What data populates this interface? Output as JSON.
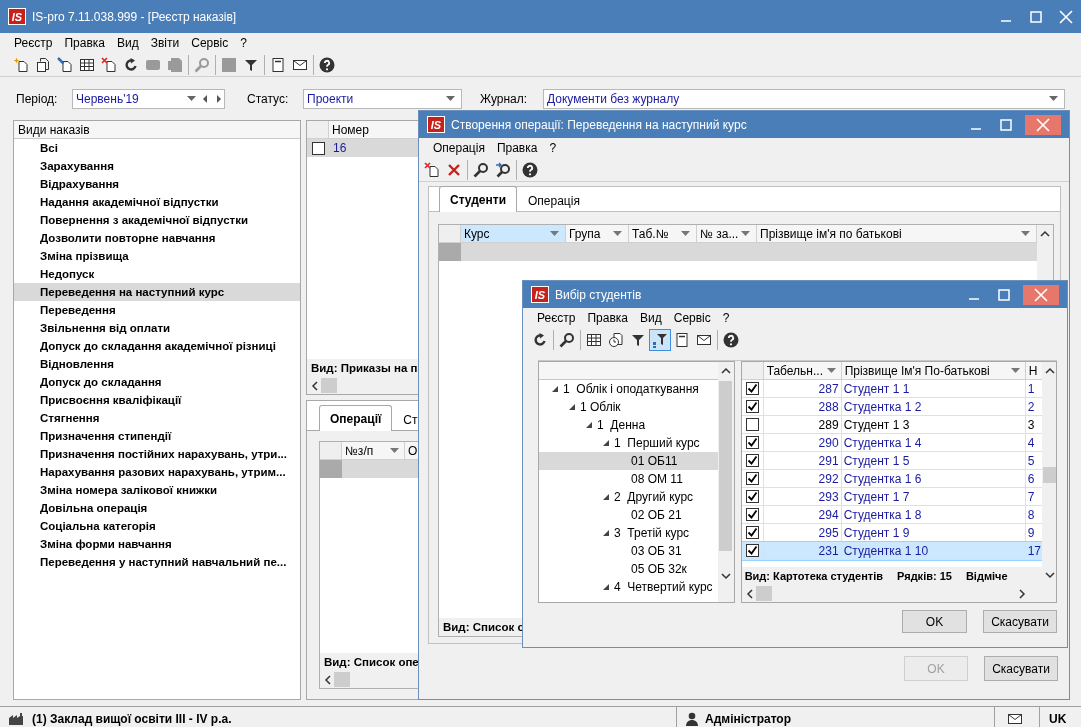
{
  "window": {
    "logo": "IS",
    "title": "IS-pro 7.11.038.999 - [Реєстр наказів]"
  },
  "menu": [
    "Реєстр",
    "Правка",
    "Вид",
    "Звіти",
    "Сервіс",
    "?"
  ],
  "toolbar": [
    {
      "kind": "new",
      "disabled": false
    },
    {
      "kind": "copy",
      "disabled": false
    },
    {
      "kind": "edit",
      "disabled": false
    },
    {
      "kind": "table",
      "disabled": false
    },
    {
      "kind": "delete",
      "disabled": false
    },
    {
      "kind": "refresh",
      "disabled": false
    },
    {
      "kind": "block",
      "disabled": true
    },
    {
      "kind": "pages",
      "disabled": true
    },
    {
      "kind": "separator"
    },
    {
      "kind": "search",
      "disabled": true
    },
    {
      "kind": "separator"
    },
    {
      "kind": "square",
      "disabled": true
    },
    {
      "kind": "filter",
      "disabled": false
    },
    {
      "kind": "separator"
    },
    {
      "kind": "document",
      "disabled": false
    },
    {
      "kind": "mail",
      "disabled": false
    },
    {
      "kind": "separator"
    },
    {
      "kind": "help",
      "disabled": false
    }
  ],
  "filters": {
    "period_label": "Період:",
    "period": "Червень'19",
    "status_label": "Статус:",
    "status": "Проекти",
    "journal_label": "Журнал:",
    "journal": "Документи без журналу"
  },
  "order_types": {
    "header": "Види наказів",
    "items": [
      {
        "label": "Всі",
        "selected": false
      },
      {
        "label": "Зарахування",
        "selected": false
      },
      {
        "label": "Відрахування",
        "selected": false
      },
      {
        "label": "Надання академічної відпустки",
        "selected": false
      },
      {
        "label": "Повернення з академічної відпустки",
        "selected": false
      },
      {
        "label": "Дозволити повторне навчання",
        "selected": false
      },
      {
        "label": "Зміна прізвища",
        "selected": false
      },
      {
        "label": "Недопуск",
        "selected": false
      },
      {
        "label": "Переведення на наступний курс",
        "selected": true
      },
      {
        "label": "Переведення",
        "selected": false
      },
      {
        "label": "Звільнення від оплати",
        "selected": false
      },
      {
        "label": "Допуск до складання академічної різниці",
        "selected": false
      },
      {
        "label": "Відновлення",
        "selected": false
      },
      {
        "label": "Допуск до складання",
        "selected": false
      },
      {
        "label": "Присвоєння кваліфікації",
        "selected": false
      },
      {
        "label": "Стягнення",
        "selected": false
      },
      {
        "label": "Призначення стипендії",
        "selected": false
      },
      {
        "label": "Призначення постійних нарахувань, утри...",
        "selected": false
      },
      {
        "label": "Нарахування разових нарахувань, утрим...",
        "selected": false
      },
      {
        "label": "Зміна номера залікової книжки",
        "selected": false
      },
      {
        "label": "Довільна операція",
        "selected": false
      },
      {
        "label": "Соціальна категорія",
        "selected": false
      },
      {
        "label": "Зміна форми навчання",
        "selected": false
      },
      {
        "label": "Переведення у наступний навчальний пе...",
        "selected": false
      }
    ]
  },
  "orders_table": {
    "columns": [
      "Номер"
    ],
    "rows": [
      {
        "number": "16",
        "checked": false,
        "selected": true
      }
    ],
    "footer": "Вид: Приказы на п"
  },
  "bottom_tabs": [
    {
      "label": "Операції",
      "selected": true
    },
    {
      "label": "Ст",
      "selected": false
    }
  ],
  "operations_table": {
    "columns": [
      "№з/п",
      "О"
    ],
    "footer": "Вид: Список опе"
  },
  "status_bar": {
    "organization": "(1) Заклад вищої освіти III - IV р.а.",
    "user": "Адміністратор",
    "language": "UK"
  },
  "operation_dialog": {
    "logo": "IS",
    "title": "Створення операції: Переведення на наступний курс",
    "menu": [
      "Операція",
      "Правка",
      "?"
    ],
    "toolbar": [
      {
        "kind": "delete"
      },
      {
        "kind": "delete-x"
      },
      {
        "kind": "separator"
      },
      {
        "kind": "search"
      },
      {
        "kind": "search-arrow"
      },
      {
        "kind": "separator"
      },
      {
        "kind": "help"
      }
    ],
    "tabs": [
      {
        "label": "Студенти",
        "selected": true
      },
      {
        "label": "Операція",
        "selected": false
      }
    ],
    "columns": [
      {
        "label": "Курс",
        "selected": true
      },
      {
        "label": "Група",
        "selected": false
      },
      {
        "label": "Таб.№",
        "selected": false
      },
      {
        "label": "№ за...",
        "selected": false
      },
      {
        "label": "Прізвище ім'я по батькові",
        "selected": false
      }
    ],
    "footer": "Вид: Список с",
    "buttons": [
      {
        "label": "OK",
        "disabled": true
      },
      {
        "label": "Скасувати",
        "disabled": false
      }
    ]
  },
  "students_dialog": {
    "logo": "IS",
    "title": "Вибір студентів",
    "menu": [
      "Реєстр",
      "Правка",
      "Вид",
      "Сервіс",
      "?"
    ],
    "toolbar": [
      {
        "kind": "refresh",
        "selected": false
      },
      {
        "kind": "separator"
      },
      {
        "kind": "search",
        "selected": false
      },
      {
        "kind": "separator"
      },
      {
        "kind": "table",
        "selected": false
      },
      {
        "kind": "clock-document",
        "selected": false
      },
      {
        "kind": "filter",
        "selected": false
      },
      {
        "kind": "filter-tree",
        "selected": true
      },
      {
        "kind": "document",
        "selected": false
      },
      {
        "kind": "mail",
        "selected": false
      },
      {
        "kind": "separator"
      },
      {
        "kind": "help",
        "selected": false
      }
    ],
    "tree": [
      {
        "label": "1  Облік і оподаткування",
        "expanded": true,
        "selected": false,
        "children": [
          {
            "label": "1 Облік",
            "expanded": true,
            "selected": false,
            "children": [
              {
                "label": "1  Денна",
                "expanded": true,
                "selected": false,
                "children": [
                  {
                    "label": "1  Перший курс",
                    "expanded": true,
                    "selected": false,
                    "children": [
                      {
                        "label": "01 ОБ11",
                        "selected": true
                      },
                      {
                        "label": "08 ОМ 11",
                        "selected": false
                      }
                    ]
                  },
                  {
                    "label": "2  Другий курс",
                    "expanded": true,
                    "selected": false,
                    "children": [
                      {
                        "label": "02 ОБ 21",
                        "selected": false
                      }
                    ]
                  },
                  {
                    "label": "3  Третій курс",
                    "expanded": true,
                    "selected": false,
                    "children": [
                      {
                        "label": "03 ОБ 31",
                        "selected": false
                      },
                      {
                        "label": "05 ОБ 32к",
                        "selected": false
                      }
                    ]
                  },
                  {
                    "label": "4  Четвертий курс",
                    "expanded": true,
                    "selected": false
                  }
                ]
              }
            ]
          }
        ]
      }
    ],
    "columns": [
      "Табельн...",
      "Прізвище Ім'я По-батькові",
      "Н"
    ],
    "rows": [
      {
        "checked": true,
        "number": "287",
        "name": "Студент 1 1",
        "column_3": "1",
        "selected": false
      },
      {
        "checked": true,
        "number": "288",
        "name": "Студентка 1 2",
        "column_3": "2",
        "selected": false
      },
      {
        "checked": false,
        "number": "289",
        "name": "Студент 1 3",
        "column_3": "3",
        "selected": false
      },
      {
        "checked": true,
        "number": "290",
        "name": "Студентка 1 4",
        "column_3": "4",
        "selected": false
      },
      {
        "checked": true,
        "number": "291",
        "name": "Студент 1 5",
        "column_3": "5",
        "selected": false
      },
      {
        "checked": true,
        "number": "292",
        "name": "Студентка 1 6",
        "column_3": "6",
        "selected": false
      },
      {
        "checked": true,
        "number": "293",
        "name": "Студент 1 7",
        "column_3": "7",
        "selected": false
      },
      {
        "checked": true,
        "number": "294",
        "name": "Студентка 1 8",
        "column_3": "8",
        "selected": false
      },
      {
        "checked": true,
        "number": "295",
        "name": "Студент 1 9",
        "column_3": "9",
        "selected": false
      },
      {
        "checked": true,
        "number": "231",
        "name": "Студентка 1 10",
        "column_3": "17",
        "selected": true
      }
    ],
    "footer": {
      "view": "Вид: Картотека студентів",
      "rows": "Рядків: 15",
      "marked": "Відміче"
    },
    "buttons": [
      {
        "label": "OK",
        "disabled": false
      },
      {
        "label": "Скасувати",
        "disabled": false
      }
    ]
  }
}
